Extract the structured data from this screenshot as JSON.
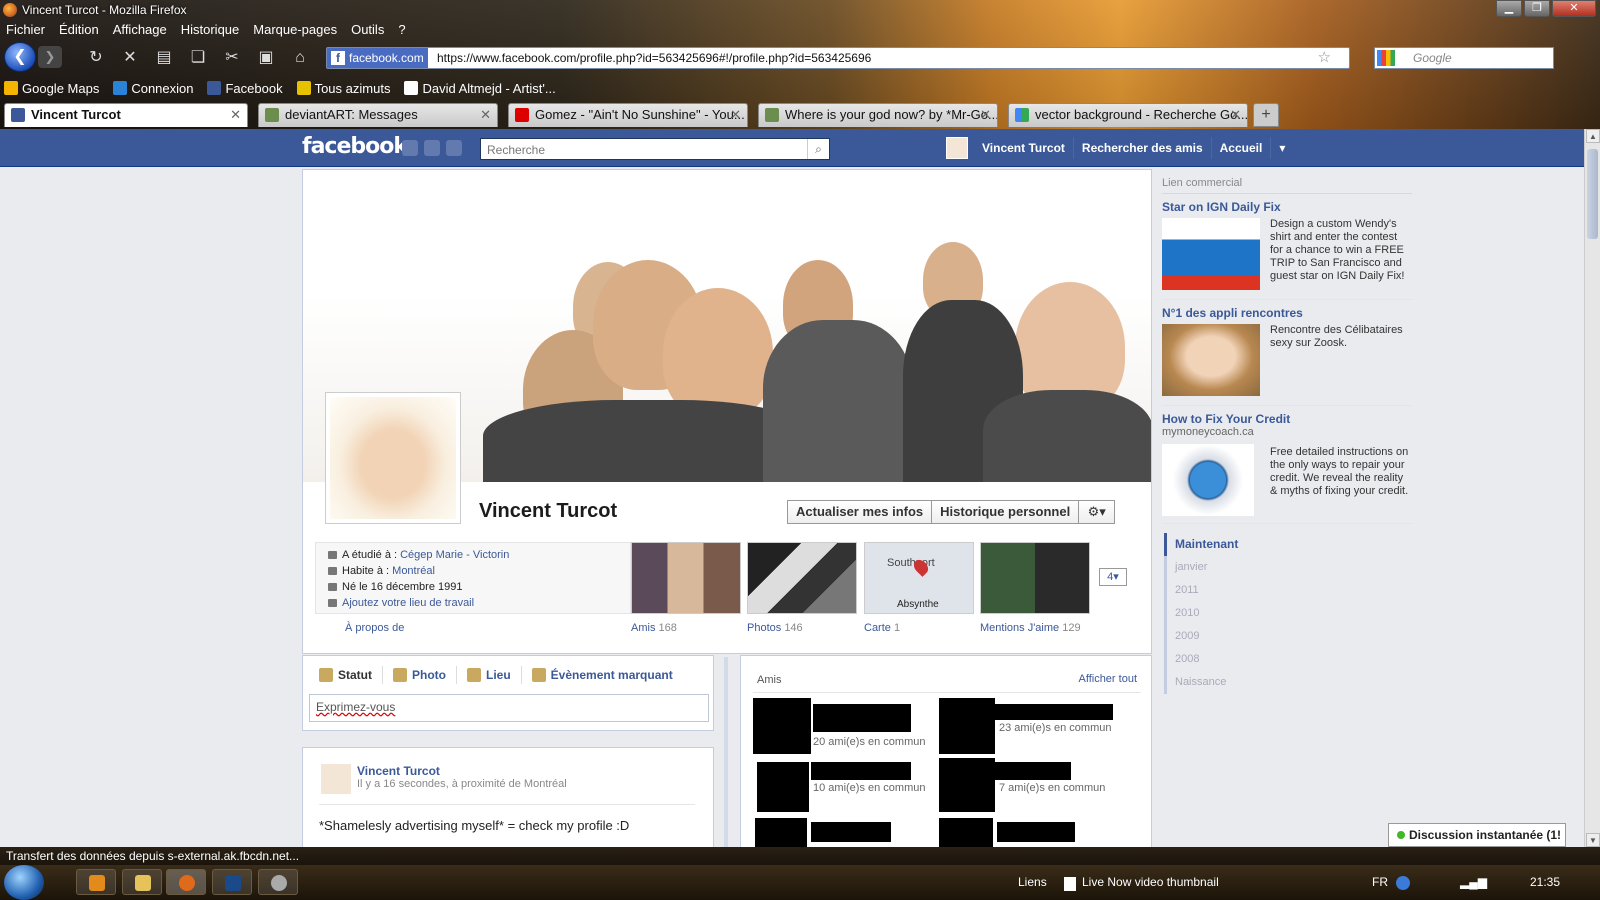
{
  "window": {
    "title": "Vincent Turcot - Mozilla Firefox",
    "menu": [
      "Fichier",
      "Édition",
      "Affichage",
      "Historique",
      "Marque-pages",
      "Outils",
      "?"
    ],
    "url_identity": "facebook.com",
    "url": "https://www.facebook.com/profile.php?id=563425696#!/profile.php?id=563425696",
    "search_placeholder": "Google",
    "bookmarks": [
      "Google Maps",
      "Connexion",
      "Facebook",
      "Tous azimuts",
      "David Altmejd - Artist'..."
    ],
    "tabs": [
      {
        "label": "Vincent Turcot",
        "active": true
      },
      {
        "label": "deviantART: Messages"
      },
      {
        "label": "Gomez - \"Ain't No Sunshine\" - You..."
      },
      {
        "label": "Where is your god now? by *Mr-Go..."
      },
      {
        "label": "vector background - Recherche Go..."
      }
    ],
    "new_tab": "+",
    "status": "Transfert des données depuis s-external.ak.fbcdn.net..."
  },
  "fb": {
    "logo": "facebook",
    "search_placeholder": "Recherche",
    "nav": {
      "user": "Vincent Turcot",
      "find_friends": "Rechercher des amis",
      "home": "Accueil"
    }
  },
  "profile": {
    "name": "Vincent Turcot",
    "btn_update": "Actualiser mes infos",
    "btn_history": "Historique personnel",
    "info": {
      "studied_label": "A étudié à :",
      "studied_value": "Cégep Marie - Victorin",
      "lives_label": "Habite à :",
      "lives_value": "Montréal",
      "born": "Né le 16 décembre 1991",
      "add_work": "Ajoutez votre lieu de travail"
    },
    "about": "À propos de",
    "thumbs": [
      {
        "label": "Amis",
        "count": "168"
      },
      {
        "label": "Photos",
        "count": "146"
      },
      {
        "label": "Carte",
        "count": "1"
      },
      {
        "label": "Mentions J'aime",
        "count": "129"
      }
    ],
    "map_text1": "Southport",
    "map_text2": "Absynthe",
    "more": "4"
  },
  "composer": {
    "tabs": [
      "Statut",
      "Photo",
      "Lieu",
      "Évènement marquant"
    ],
    "placeholder": "Exprimez-vous"
  },
  "post": {
    "author": "Vincent Turcot",
    "meta": "Il y a 16 secondes, à proximité de Montréal",
    "text": "*Shamelesly advertising myself* = check my profile :D"
  },
  "friends": {
    "header": "Amis",
    "see_all": "Afficher tout",
    "mutual": [
      "20 ami(e)s en commun",
      "23 ami(e)s en commun",
      "10 ami(e)s en commun",
      "7 ami(e)s en commun"
    ]
  },
  "ads": {
    "header": "Lien commercial",
    "items": [
      {
        "title": "Star on IGN Daily Fix",
        "sub": "",
        "text": "Design a custom Wendy's shirt and enter the contest for a chance to win a FREE TRIP to San Francisco and guest star on IGN Daily Fix!"
      },
      {
        "title": "N°1 des appli rencontres",
        "sub": "",
        "text": "Rencontre des Célibataires sexy sur Zoosk."
      },
      {
        "title": "How to Fix Your Credit",
        "sub": "mymoneycoach.ca",
        "text": "Free detailed instructions on the only ways to repair your credit. We reveal the reality & myths of fixing your credit."
      }
    ]
  },
  "timeline": [
    "Maintenant",
    "janvier",
    "2011",
    "2010",
    "2009",
    "2008",
    "Naissance"
  ],
  "chat": "Discussion instantanée (1!",
  "taskbar": {
    "links": "Liens",
    "live": "Live Now video thumbnail",
    "lang": "FR",
    "clock": "21:35"
  }
}
